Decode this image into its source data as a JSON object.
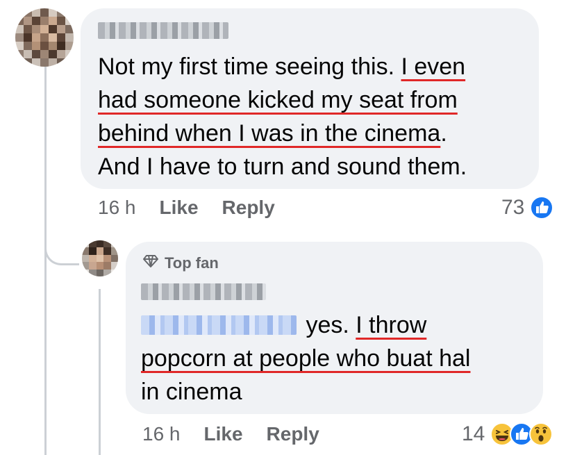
{
  "colors": {
    "bubble": "#f0f2f5",
    "text": "#050505",
    "meta": "#65676b",
    "underline": "#e02828",
    "like_blue": "#1877f2",
    "thread_line": "#ccd0d5"
  },
  "comment": {
    "author": "Carol Cheng",
    "text_part1": "Not my first time seeing this. ",
    "text_underlined_a": "I even",
    "text_underlined_b": "had someone kicked my seat from",
    "text_underlined_c": "behind when I was in the cinema",
    "text_part2": ".",
    "text_part3": "And I have to turn and sound them.",
    "time": "16 h",
    "like_label": "Like",
    "reply_label": "Reply",
    "reaction_count": "73",
    "reaction_icons": [
      "like-icon"
    ]
  },
  "reply": {
    "badge_label": "Top fan",
    "badge_icon": "diamond-icon",
    "author": "Holly Hood",
    "mention": "Carol Cheng",
    "text_part1": " yes. ",
    "text_underlined_a": "I throw",
    "text_underlined_b": "popcorn at people who buat hal",
    "text_part2": "in cinema",
    "time": "16 h",
    "like_label": "Like",
    "reply_label": "Reply",
    "reaction_count": "14",
    "reaction_icons": [
      "haha-icon",
      "like-icon",
      "wow-icon"
    ]
  }
}
